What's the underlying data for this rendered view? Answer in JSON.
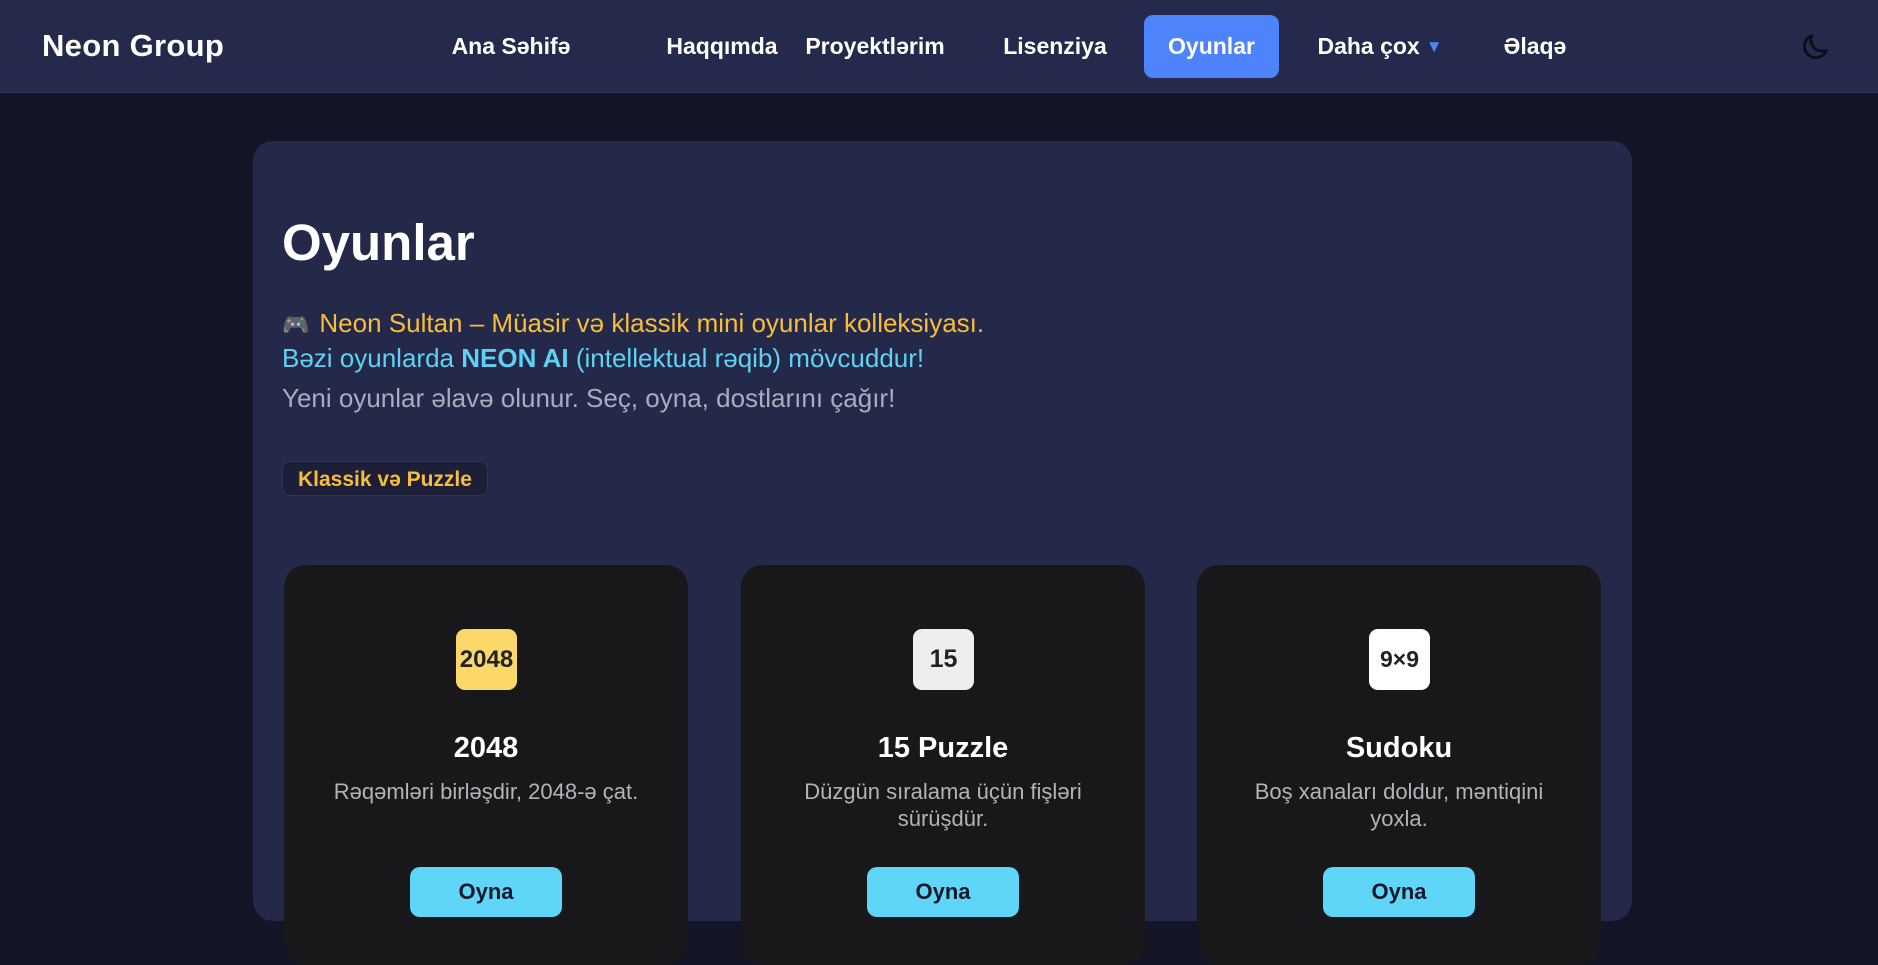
{
  "navbar": {
    "brand": "Neon Group",
    "links": [
      {
        "label": "Ana Səhifə"
      },
      {
        "label": "Haqqımda"
      },
      {
        "label": "Proyektlərim"
      },
      {
        "label": "Lisenziya"
      },
      {
        "label": "Oyunlar",
        "active": true
      },
      {
        "label": "Daha çox",
        "has_dropdown": true
      },
      {
        "label": "Əlaqə"
      }
    ],
    "dropdown_caret": "▼",
    "theme_toggle_icon": "moon-icon"
  },
  "main": {
    "title": "Oyunlar",
    "intro_icon": "🎮",
    "intro_line1": "Neon Sultan – Müasir və klassik mini oyunlar kolleksiyası.",
    "intro_line2_prefix": "Bəzi oyunlarda ",
    "intro_line2_bold": "NEON AI",
    "intro_line2_suffix": " (intellektual rəqib) mövcuddur!",
    "intro_line3": "Yeni oyunlar əlavə olunur. Seç, oyna, dostlarını çağır!",
    "category": "Klassik və Puzzle",
    "games": [
      {
        "tile": "2048",
        "name": "2048",
        "description": "Rəqəmləri birləşdir, 2048-ə çat.",
        "button": "Oyna"
      },
      {
        "tile": "15",
        "name": "15 Puzzle",
        "description": "Düzgün sıralama üçün fişləri sürüşdür.",
        "button": "Oyna"
      },
      {
        "tile": "9×9",
        "name": "Sudoku",
        "description": "Boş xanaları doldur, məntiqini yoxla.",
        "button": "Oyna"
      }
    ]
  },
  "colors": {
    "page_bg": "#141627",
    "navbar_bg": "#252a4c",
    "accent_blue": "#4d84fb",
    "accent_yellow": "#f7be3c",
    "accent_cyan": "#5fd2f3",
    "card_bg": "#242849",
    "game_card_bg": "#18181b",
    "tile_2048": "#fcd86a",
    "tile_15": "#eeeeee",
    "tile_sudoku": "#ffffff"
  }
}
